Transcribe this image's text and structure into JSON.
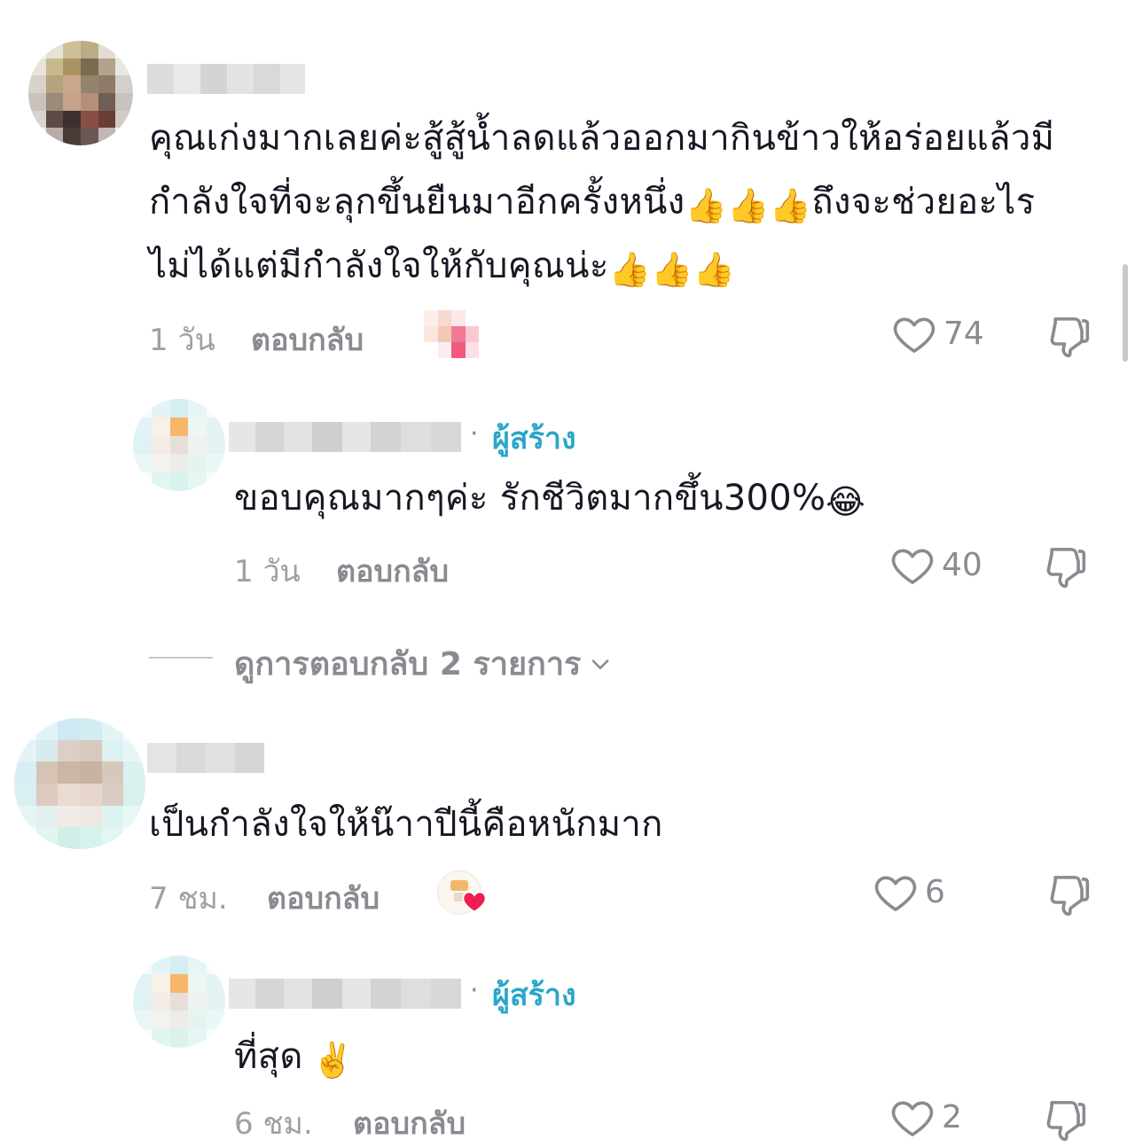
{
  "comments": [
    {
      "text": "คุณเก่งมากเลยค่ะสู้สู้น้ำลดแล้วออกมากินข้าวให้อร่อยแล้วมีกำลังใจที่จะลุกขึ้นยืนมาอีกครั้งหนึ่ง👍👍👍ถึงจะช่วยอะไรไม่ได้แต่มีกำลังใจให้กับคุณน่ะ👍👍👍",
      "line1": "คุณเก่งมากเลยค่ะสู้สู้น้ำลดแล้วออกมากินข้าวให้อร่อยแล้วมี",
      "line2_a": "กำลังใจที่จะลุกขึ้นยืนมาอีกครั้งหนึ่ง",
      "line2_emoji": "👍👍👍",
      "line2_b": "ถึงจะช่วยอะไร",
      "line3_a": "ไม่ได้แต่มีกำลังใจให้กับคุณน่ะ",
      "line3_emoji": "👍👍👍",
      "time": "1 วัน",
      "reply_label": "ตอบกลับ",
      "likes": "74",
      "reply": {
        "creator_label": "ผู้สร้าง",
        "separator": "·",
        "text": "ขอบคุณมากๆค่ะ รักชีวิตมากขึ้น300%",
        "emoji": "😂",
        "time": "1 วัน",
        "reply_label": "ตอบกลับ",
        "likes": "40"
      },
      "view_replies": "ดูการตอบกลับ 2 รายการ"
    },
    {
      "text": "เป็นกำลังใจให้น๊าาปีนี้คือหนักมาก",
      "time": "7 ชม.",
      "reply_label": "ตอบกลับ",
      "likes": "6",
      "reply": {
        "creator_label": "ผู้สร้าง",
        "separator": "·",
        "text": "ที่สุด",
        "emoji": "✌️",
        "time": "6 ชม.",
        "reply_label": "ตอบกลับ",
        "likes": "2"
      }
    }
  ],
  "icons": {
    "like": "heart-outline-icon",
    "dislike": "thumbs-down-outline-icon",
    "expand": "chevron-down-icon"
  },
  "colors": {
    "creator": "#2aa7c9",
    "meta": "#8a8b91",
    "text": "#161823"
  }
}
